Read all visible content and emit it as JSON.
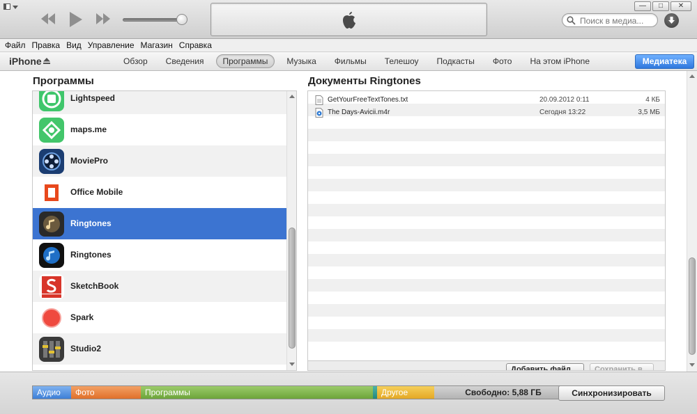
{
  "player": {
    "search_placeholder": "Поиск в медиа..."
  },
  "window_buttons": {
    "minimize": "—",
    "restore": "□",
    "close": "✕"
  },
  "menu": [
    "Файл",
    "Правка",
    "Вид",
    "Управление",
    "Магазин",
    "Справка"
  ],
  "nav": {
    "device": "iPhone",
    "tabs": [
      "Обзор",
      "Сведения",
      "Программы",
      "Музыка",
      "Фильмы",
      "Телешоу",
      "Подкасты",
      "Фото",
      "На этом iPhone"
    ],
    "active_tab": "Программы",
    "library_button": "Медиатека"
  },
  "apps_panel": {
    "title": "Программы",
    "items": [
      {
        "name": "Lightspeed",
        "icon": "lightspeed-icon"
      },
      {
        "name": "maps.me",
        "icon": "mapsme-icon"
      },
      {
        "name": "MoviePro",
        "icon": "moviepro-icon"
      },
      {
        "name": "Office Mobile",
        "icon": "office-icon"
      },
      {
        "name": "Ringtones",
        "icon": "ringtones-icon",
        "selected": true
      },
      {
        "name": "Ringtones",
        "icon": "ringtones-blue-icon"
      },
      {
        "name": "SketchBook",
        "icon": "sketchbook-icon"
      },
      {
        "name": "Spark",
        "icon": "spark-icon"
      },
      {
        "name": "Studio2",
        "icon": "studio2-icon"
      }
    ]
  },
  "docs_panel": {
    "title": "Документы Ringtones",
    "files": [
      {
        "name": "GetYourFreeTextTones.txt",
        "date": "20.09.2012 0:11",
        "size": "4 КБ",
        "icon": "text-file-icon"
      },
      {
        "name": "The Days-Avicii.m4r",
        "date": "Сегодня 13:22",
        "size": "3,5 МБ",
        "icon": "audio-file-icon"
      }
    ],
    "add_button": "Добавить файл...",
    "save_button": "Сохранить в..."
  },
  "storage": {
    "audio": "Аудио",
    "photo": "Фото",
    "apps": "Программы",
    "other": "Другое",
    "free": "Свободно: 5,88 ГБ",
    "sync_button": "Синхронизировать"
  }
}
